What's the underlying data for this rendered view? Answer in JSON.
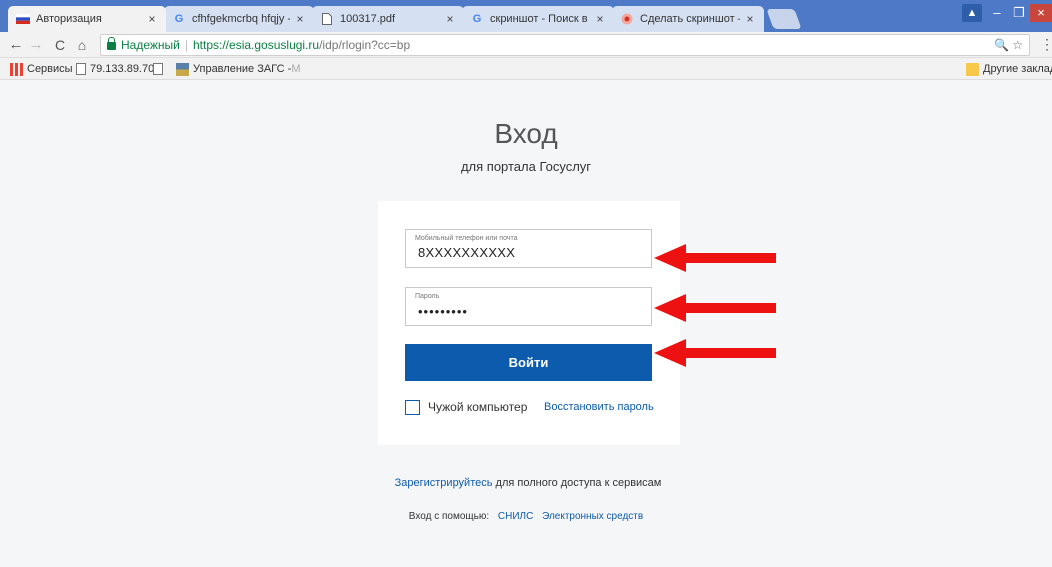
{
  "browser": {
    "tabs": [
      {
        "title": "Авторизация",
        "favicon": "russia-flag-icon",
        "active": true
      },
      {
        "title": "cfhfgekmcrbq hfqjy - По",
        "favicon": "google-icon",
        "active": false
      },
      {
        "title": "100317.pdf",
        "favicon": "document-icon",
        "active": false
      },
      {
        "title": "скриншот - Поиск в Goo",
        "favicon": "google-icon",
        "active": false
      },
      {
        "title": "Сделать скриншот — О",
        "favicon": "record-icon",
        "active": false
      }
    ],
    "tab_close": "×",
    "window_controls": {
      "minimize": "–",
      "maximize": "❐",
      "close": "×",
      "user": "▲"
    },
    "nav": {
      "back": "←",
      "forward": "→",
      "reload": "C",
      "home": "⌂"
    },
    "address": {
      "secure_label": "Надежный",
      "scheme": "https://",
      "host": "esia.gosuslugi.ru",
      "path": "/idp/rlogin?cc=bp",
      "icons": "🔍 ☆"
    },
    "menu": "⋮",
    "bookmarks": {
      "apps": "Сервисы",
      "ip": "79.133.89.70",
      "zags": "Управление ЗАГС - ",
      "zags_faded": "М",
      "other": "Другие закладки"
    }
  },
  "login": {
    "title": "Вход",
    "subtitle": "для портала Госуслуг",
    "phone_label": "Мобильный телефон или почта",
    "phone_value": "8XXXXXXXXXX",
    "password_label": "Пароль",
    "password_value": "•••••••••",
    "submit": "Войти",
    "remember_label": "Чужой компьютер",
    "restore_link": "Восстановить пароль"
  },
  "footer": {
    "register_link": "Зарегистрируйтесь",
    "register_text": " для полного доступа к сервисам",
    "alt_prefix": "Вход с помощью:",
    "alt_snils": "СНИЛС",
    "alt_esig": "Электронных средств"
  },
  "colors": {
    "titlebar": "#4e79c6",
    "accent": "#0d5bad",
    "arrow": "#ee1111",
    "secure": "#0b8043"
  }
}
